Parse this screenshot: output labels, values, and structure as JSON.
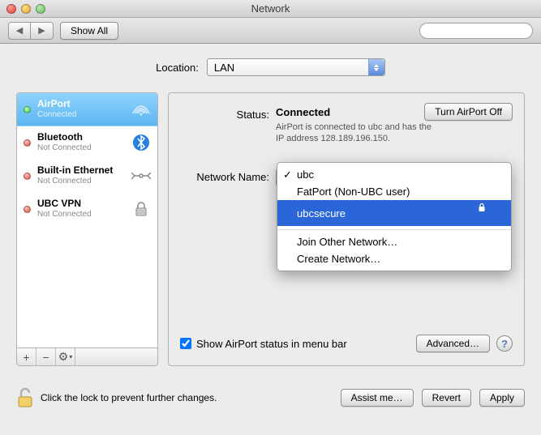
{
  "window": {
    "title": "Network"
  },
  "toolbar": {
    "back_label": "◀",
    "forward_label": "▶",
    "show_all": "Show All",
    "search_placeholder": ""
  },
  "location": {
    "label": "Location:",
    "value": "LAN"
  },
  "sidebar": {
    "items": [
      {
        "name": "AirPort",
        "status": "Connected",
        "dot": "green",
        "icon": "airport"
      },
      {
        "name": "Bluetooth",
        "status": "Not Connected",
        "dot": "red",
        "icon": "bluetooth"
      },
      {
        "name": "Built-in Ethernet",
        "status": "Not Connected",
        "dot": "red",
        "icon": "ethernet"
      },
      {
        "name": "UBC VPN",
        "status": "Not Connected",
        "dot": "red",
        "icon": "vpn"
      }
    ],
    "add": "+",
    "remove": "−",
    "gear": "⚙"
  },
  "detail": {
    "status_label": "Status:",
    "status_value": "Connected",
    "status_desc": "AirPort is connected to ubc and has the IP address 128.189.196.150.",
    "turn_off": "Turn AirPort Off",
    "network_name_label": "Network Name:",
    "show_status_label": "Show AirPort status in menu bar",
    "advanced": "Advanced…",
    "help": "?"
  },
  "network_menu": {
    "items": [
      {
        "label": "ubc",
        "checked": true
      },
      {
        "label": "FatPort (Non-UBC user)"
      },
      {
        "label": "ubcsecure",
        "selected": true,
        "locked": true
      }
    ],
    "join_other": "Join Other Network…",
    "create": "Create Network…"
  },
  "footer": {
    "lock_note": "Click the lock to prevent further changes.",
    "assist": "Assist me…",
    "revert": "Revert",
    "apply": "Apply"
  }
}
